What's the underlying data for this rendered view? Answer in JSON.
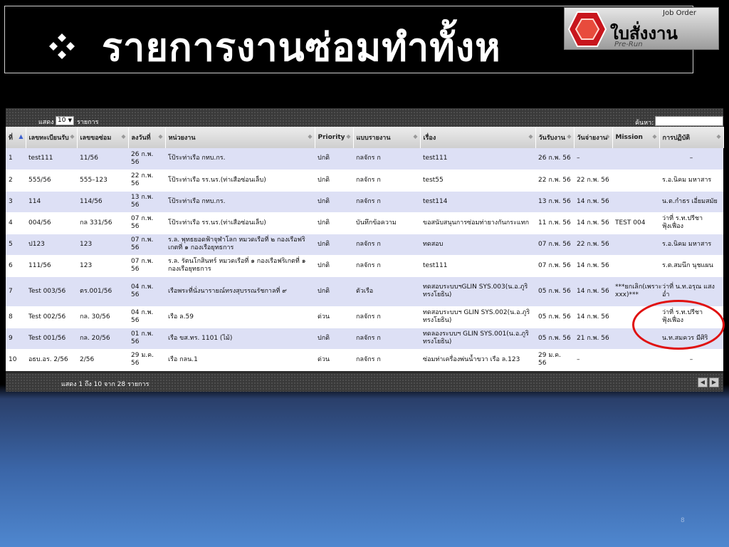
{
  "slide": {
    "title": "รายการงานซ่อมทำทั้งห",
    "page_number": "8"
  },
  "logo": {
    "text": "ใบสั่งงาน",
    "sub": "Job Order",
    "sub2": "Pre-Run"
  },
  "controls": {
    "show_label": "แสดง",
    "length_value": "10",
    "records_label": "รายการ",
    "search_label": "ค้นหา:",
    "search_value": ""
  },
  "table": {
    "columns": [
      "ที่",
      "เลขทะเบียนรับ",
      "เลขขอซ่อม",
      "ลงวันที่",
      "หน่วยงาน",
      "Priority",
      "แบบรายงาน",
      "เรื่อง",
      "วันรับงาน",
      "วันจ่ายงาน",
      "Mission",
      "การปฏิบัติ"
    ],
    "rows": [
      [
        "1",
        "test111",
        "11/56",
        "26 ก.พ. 56",
        "โป้ระท่าเรือ กทบ.กร.",
        "ปกติ",
        "กลจักร ก",
        "test111",
        "26 ก.พ. 56",
        "–",
        "",
        "–"
      ],
      [
        "2",
        "555/56",
        "555–123",
        "22 ก.พ. 56",
        "โป้ระท่าเรือ รร.นร.(ท่าเสือซ่อนเล็บ)",
        "ปกติ",
        "กลจักร ก",
        "test55",
        "22 ก.พ. 56",
        "22 ก.พ. 56",
        "",
        "ร.อ.นิคม มหาสาร"
      ],
      [
        "3",
        "114",
        "114/56",
        "13 ก.พ. 56",
        "โป้ระท่าเรือ กทบ.กร.",
        "ปกติ",
        "กลจักร ก",
        "test114",
        "13 ก.พ. 56",
        "14 ก.พ. 56",
        "",
        "น.ต.กำธร เอี่ยมสมัย"
      ],
      [
        "4",
        "004/56",
        "กล 331/56",
        "07 ก.พ. 56",
        "โป้ระท่าเรือ รร.นร.(ท่าเสือซ่อนเล็บ)",
        "ปกติ",
        "บันทึกข้อความ",
        "ขอสนับสนุนการซ่อมท่ายางกันกระแทก",
        "11 ก.พ. 56",
        "14 ก.พ. 56",
        "TEST 004",
        "ว่าที่ ร.ท.ปรีชา ฟุ้งเฟื่อง"
      ],
      [
        "5",
        "ป123",
        "123",
        "07 ก.พ. 56",
        "ร.ล. พุทธยอดฟ้าจุฬาโลก หมวดเรือที่ ๒ กองเรือฟริเกตที่ ๑ กองเรือยุทธการ",
        "ปกติ",
        "กลจักร ก",
        "ทดสอบ",
        "07 ก.พ. 56",
        "22 ก.พ. 56",
        "",
        "ร.อ.นิคม มหาสาร"
      ],
      [
        "6",
        "111/56",
        "123",
        "07 ก.พ. 56",
        "ร.ล. รัตนโกสินทร์ หมวดเรือที่ ๑ กองเรือฟริเกตที่ ๑ กองเรือยุทธการ",
        "ปกติ",
        "กลจักร ก",
        "test111",
        "07 ก.พ. 56",
        "14 ก.พ. 56",
        "",
        "ร.ต.สมนึก นุชแผน"
      ],
      [
        "7",
        "Test 003/56",
        "ตร.001/56",
        "04 ก.พ. 56",
        "เรือพระที่นั่งนารายณ์ทรงสุบรรณรัชกาลที่ ๙",
        "ปกติ",
        "ตัวเรือ",
        "ทดสอบระบบฯGLIN SYS.003(น.อ.ภูริ ทรงโยธิน)",
        "05 ก.พ. 56",
        "14 ก.พ. 56",
        "***ยกเลิก(เพราะ xxx)***",
        "ว่าที่ น.ท.อรุณ แสงอ่ำ"
      ],
      [
        "8",
        "Test 002/56",
        "กล. 30/56",
        "04 ก.พ. 56",
        "เรือ ล.59",
        "ด่วน",
        "กลจักร ก",
        "ทดสอบระบบฯ GLIN SYS.002(น.อ.ภูริ ทรงโยธิน)",
        "05 ก.พ. 56",
        "14 ก.พ. 56",
        "",
        "ว่าที่ ร.ท.ปรีชา ฟุ้งเฟื่อง"
      ],
      [
        "9",
        "Test 001/56",
        "กล. 20/56",
        "01 ก.พ. 56",
        "เรือ ขส.ทร. 1101 (ไม้)",
        "ปกติ",
        "กลจักร ก",
        "ทดลองระบบฯ GLIN SYS.001(น.อ.ภูริ ทรงโยธิน)",
        "05 ก.พ. 56",
        "21 ก.พ. 56",
        "",
        "น.ท.สมควร มีศิริ"
      ],
      [
        "10",
        "อธบ.อร. 2/56",
        "2/56",
        "29 ม.ค. 56",
        "เรือ กลน.1",
        "ด่วน",
        "กลจักร ก",
        "ซ่อมท่าเครื่องพ่นน้ำขวา เรือ ล.123",
        "29 ม.ค. 56",
        "–",
        "",
        "–"
      ]
    ]
  },
  "footer": {
    "info": "แสดง 1 ถึง 10 จาก 28 รายการ",
    "prev_icon": "arrow-left-icon",
    "next_icon": "arrow-right-icon"
  },
  "colors": {
    "row_odd": "#dde0f5",
    "row_even": "#ffffff",
    "highlight": "#e01010"
  }
}
